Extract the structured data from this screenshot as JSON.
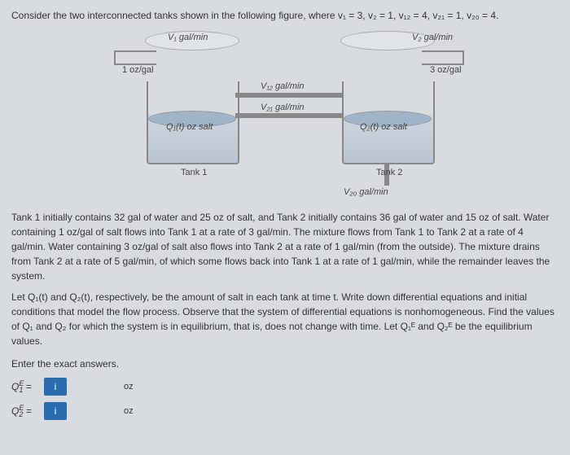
{
  "problem": {
    "intro": "Consider the two interconnected tanks shown in the following figure, where v₁ = 3, v₂ = 1, v₁₂ = 4, v₂₁ = 1, v₂₀ = 4.",
    "figure": {
      "V1": "V₁ gal/min",
      "V2": "V₂ gal/min",
      "in1": "1 oz/gal",
      "in2": "3 oz/gal",
      "Q1": "Q₁(t) oz salt",
      "Q2": "Q₂(t) oz salt",
      "V12": "V₁₂ gal/min",
      "V21": "V₂₁ gal/min",
      "V20": "V₂₀ gal/min",
      "tank1": "Tank 1",
      "tank2": "Tank 2"
    },
    "para1": "Tank 1 initially contains 32 gal of water and 25 oz of salt, and Tank 2 initially contains 36 gal of water and 15 oz of salt. Water containing 1 oz/gal of salt flows into Tank 1 at a rate of 3 gal/min. The mixture flows from Tank 1 to Tank 2 at a rate of 4 gal/min. Water containing 3 oz/gal of salt also flows into Tank 2 at a rate of 1 gal/min (from the outside). The mixture drains from Tank 2 at a rate of 5 gal/min, of which some flows back into Tank 1 at a rate of 1 gal/min, while the remainder leaves the system.",
    "para2": "Let Q₁(t) and Q₂(t), respectively, be the amount of salt in each tank at time t. Write down differential equations and initial conditions that model the flow process. Observe that the system of differential equations is nonhomogeneous. Find the values of Q₁ and Q₂ for which the system is in equilibrium, that is, does not change with time. Let Q₁ᴱ and Q₂ᴱ be the equilibrium values.",
    "prompt": "Enter the exact answers."
  },
  "answers": {
    "q1label": "Q₁ᴱ =",
    "q2label": "Q₂ᴱ =",
    "box": "i",
    "unit1": "oz",
    "unit2": "oz"
  }
}
